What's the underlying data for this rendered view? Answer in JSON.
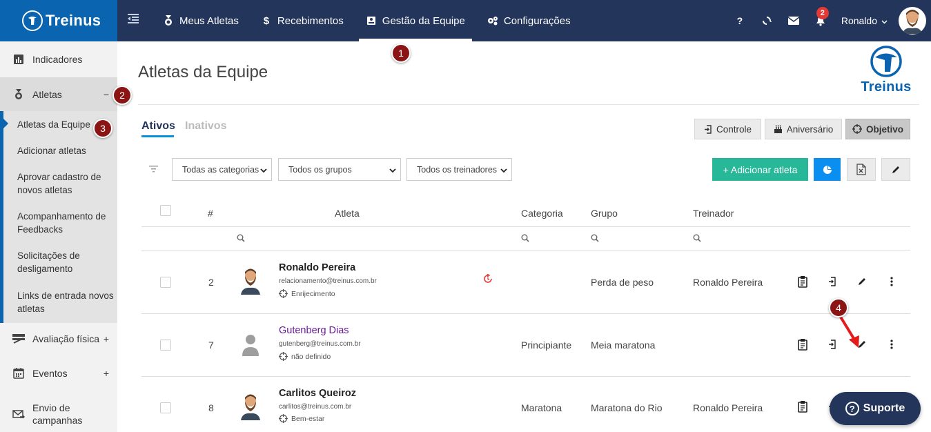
{
  "app": {
    "logo_text": "Treinus",
    "brand_color": "#0b64b0",
    "nav_bg": "#24355c"
  },
  "topnav": {
    "items": [
      {
        "label": "Meus Atletas",
        "icon": "medal-icon"
      },
      {
        "label": "Recebimentos",
        "icon": "dollar-icon"
      },
      {
        "label": "Gestão da Equipe",
        "icon": "id-card-icon",
        "active": true
      },
      {
        "label": "Configurações",
        "icon": "gears-icon"
      }
    ],
    "help": "?",
    "notifications_count": "2",
    "user_name": "Ronaldo"
  },
  "sidebar": {
    "indicadores": "Indicadores",
    "atletas": "Atletas",
    "atletas_sign": "−",
    "sub": [
      "Atletas da Equipe",
      "Adicionar atletas",
      "Aprovar cadastro de novos atletas",
      "Acompanhamento de Feedbacks",
      "Solicitações de desligamento",
      "Links de entrada novos atletas"
    ],
    "avaliacao": "Avaliação física",
    "eventos": "Eventos",
    "envio": "Envio de campanhas",
    "plus": "+"
  },
  "markers": [
    "1",
    "2",
    "3",
    "4"
  ],
  "page": {
    "title": "Atletas da Equipe",
    "brand_text": "Treinus",
    "tabs": {
      "ativos": "Ativos",
      "inativos": "Inativos"
    },
    "buttons": {
      "controle": "Controle",
      "aniversario": "Aniversário",
      "objetivo": "Objetivo"
    },
    "filters": {
      "categorias": "Todas as categorias",
      "grupos": "Todos os grupos",
      "treinadores": "Todos os treinadores"
    },
    "add_button": "+ Adicionar atleta"
  },
  "table": {
    "headers": {
      "num": "#",
      "atleta": "Atleta",
      "categoria": "Categoria",
      "grupo": "Grupo",
      "treinador": "Treinador"
    },
    "rows": [
      {
        "num": "2",
        "name": "Ronaldo Pereira",
        "email": "relacionamento@treinus.com.br",
        "goal": "Enrijecimento",
        "categoria": "",
        "grupo": "Perda de peso",
        "treinador": "Ronaldo Pereira",
        "avatar": "bearded-avatar"
      },
      {
        "num": "7",
        "name": "Gutenberg Dias",
        "email": "gutenberg@treinus.com.br",
        "goal": "não definido",
        "categoria": "Principiante",
        "grupo": "Meia maratona",
        "treinador": "",
        "avatar": "default-avatar"
      },
      {
        "num": "8",
        "name": "Carlitos Queiroz",
        "email": "carlitos@treinus.com.br",
        "goal": "Bem-estar",
        "categoria": "Maratona",
        "grupo": "Maratona do Rio",
        "treinador": "Ronaldo Pereira",
        "avatar": "bearded-avatar"
      }
    ]
  },
  "support": {
    "label": "Suporte"
  }
}
